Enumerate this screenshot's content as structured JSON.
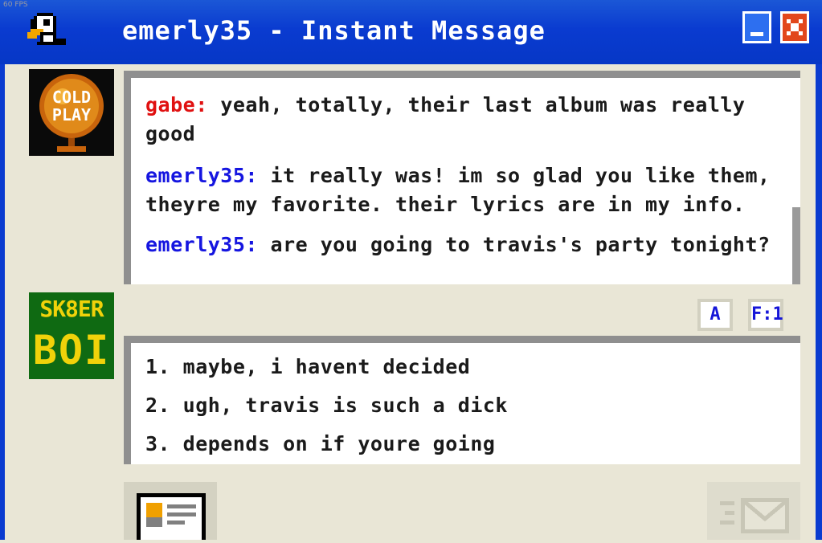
{
  "fps": "60 FPS",
  "window": {
    "title": "emerly35 - Instant Message",
    "minimize_icon": "minimize-icon",
    "close_icon": "close-icon",
    "app_icon": "duck-icon"
  },
  "buddy_avatar": {
    "label_top": "COLD",
    "label_bottom": "PLAY",
    "icon": "coldplay-globe-icon"
  },
  "self_avatar": {
    "line1": "SK8ER",
    "line2": "BOI"
  },
  "chat": {
    "messages": [
      {
        "sender": "gabe",
        "text": " yeah, totally, their last album was really good"
      },
      {
        "sender": "emerly35",
        "text": " it really was! im so glad you like them, theyre my favorite. their lyrics are in my info."
      },
      {
        "sender": "emerly35",
        "text": " are you going to travis's party tonight?"
      }
    ]
  },
  "toolbar": {
    "font_label": "A",
    "face_label": "F:1"
  },
  "replies": [
    "1. maybe, i havent decided",
    "2. ugh, travis is such a dick",
    "3. depends on if youre going"
  ],
  "colors": {
    "titlebar": "#0a3bd0",
    "buddy_screenname": "#e01010",
    "self_screenname": "#1515e0",
    "avatar_self_bg": "#0f6a12",
    "avatar_self_text": "#f0d20a"
  },
  "buttons": {
    "profile_icon": "profile-card-icon",
    "send_icon": "send-envelope-icon"
  }
}
